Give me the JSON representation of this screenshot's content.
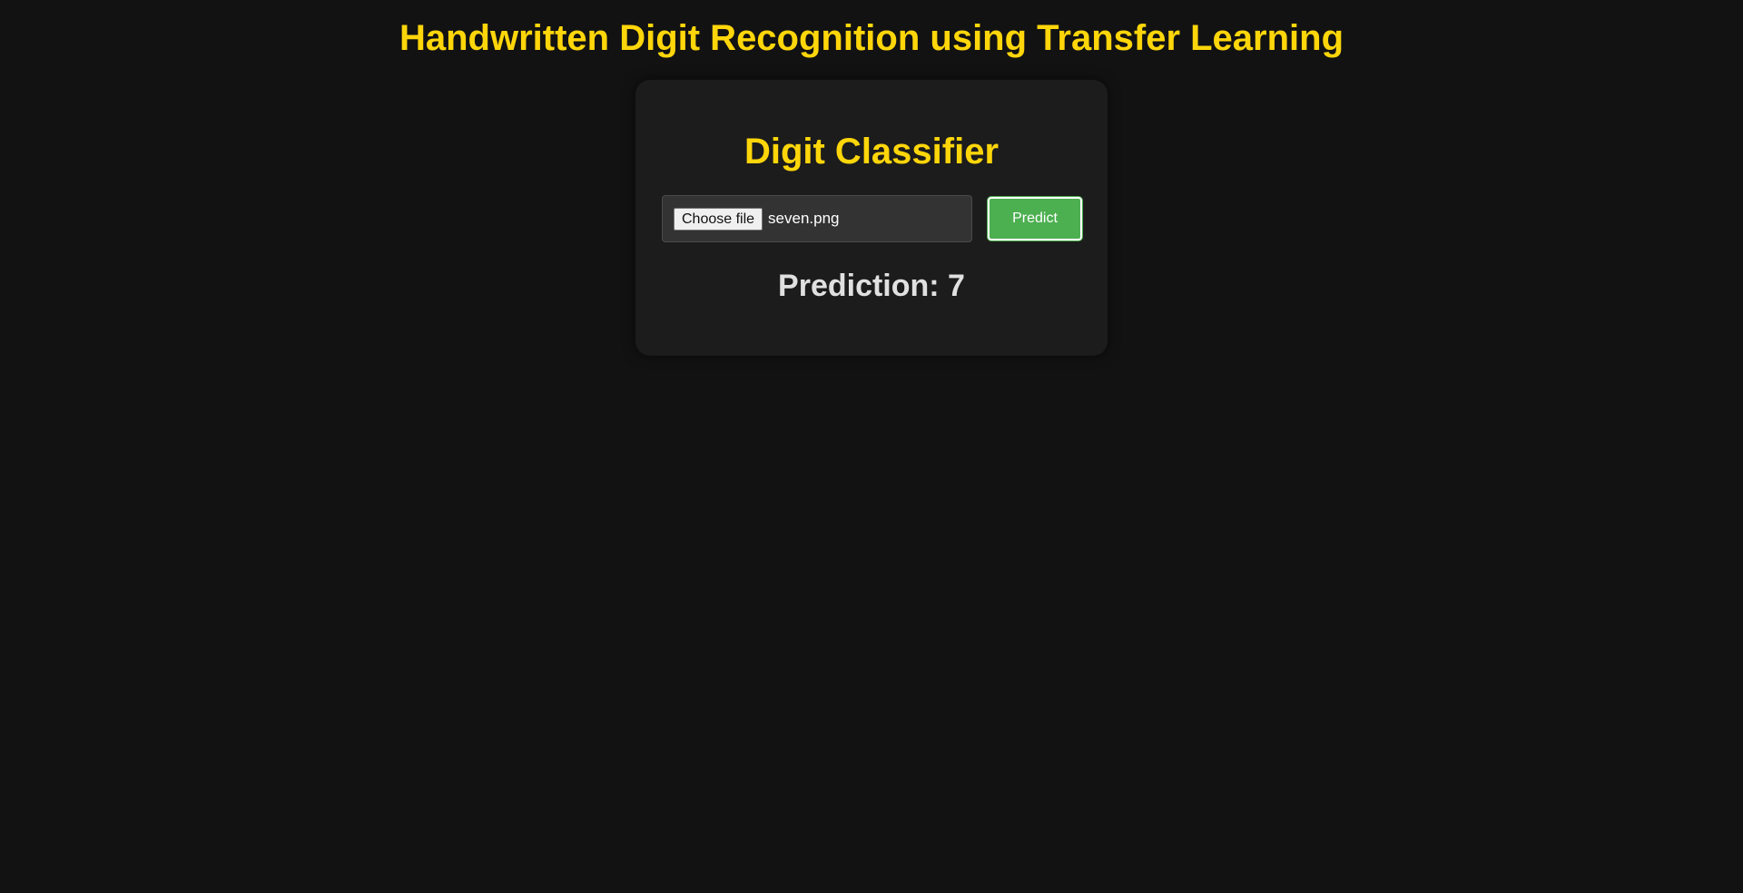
{
  "header": {
    "title": "Handwritten Digit Recognition using Transfer Learning"
  },
  "card": {
    "title": "Digit Classifier",
    "file_input": {
      "button_label": "Choose file",
      "selected_file": "seven.png"
    },
    "predict_label": "Predict",
    "prediction_text": "Prediction: 7"
  },
  "colors": {
    "background": "#121212",
    "card": "#1c1c1c",
    "accent_yellow": "#ffd60a",
    "button_green": "#4caf50"
  }
}
